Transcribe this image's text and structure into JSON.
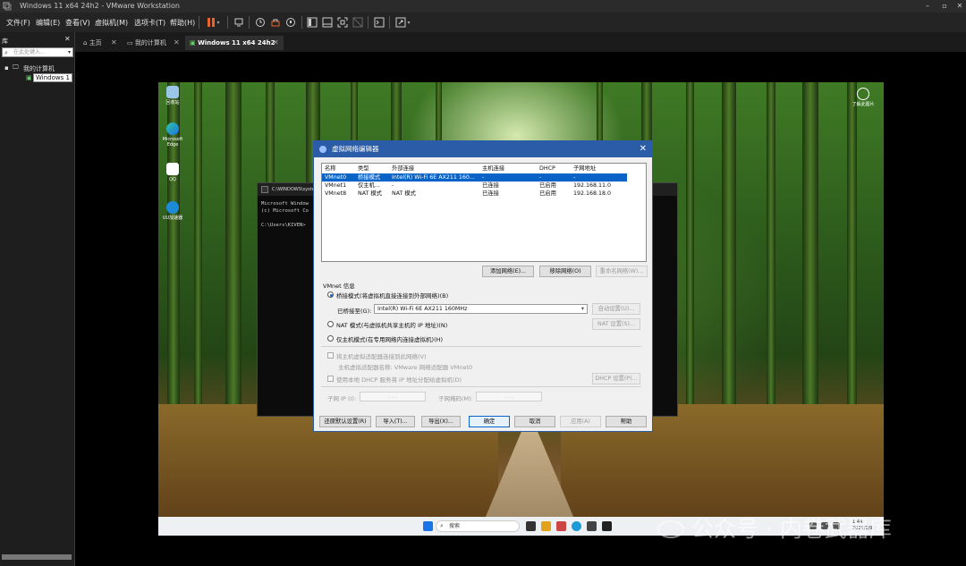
{
  "window": {
    "title": "Windows 11 x64 24h2 - VMware Workstation"
  },
  "menu": [
    "文件(F)",
    "编辑(E)",
    "查看(V)",
    "虚拟机(M)",
    "选项卡(T)",
    "帮助(H)"
  ],
  "library": {
    "title": "库",
    "search_placeholder": "在此处键入...",
    "tree_root": "我的计算机",
    "tree_vm": "Windows 1"
  },
  "tabs": [
    {
      "label": "主页"
    },
    {
      "label": "我的计算机"
    },
    {
      "label": "Windows 11 x64 24h2"
    }
  ],
  "desktop": {
    "icons": [
      {
        "label": "回收站"
      },
      {
        "label": "Microsoft Edge"
      },
      {
        "label": "QQ"
      },
      {
        "label": "UU加速器"
      }
    ],
    "top_right_label": "了解此图片",
    "taskbar_search": "搜索",
    "clock_time": "1:44",
    "clock_date": "2025/1/9"
  },
  "cmd": {
    "title": "C:\\WINDOWS\\syste",
    "lines": [
      "Microsoft Window",
      "(c) Microsoft Co",
      "",
      "C:\\Users\\KIVEN>"
    ]
  },
  "dialog": {
    "title": "虚拟网络编辑器",
    "columns": [
      "名称",
      "类型",
      "外部连接",
      "主机连接",
      "DHCP",
      "子网地址"
    ],
    "rows": [
      {
        "name": "VMnet0",
        "type": "桥接模式",
        "ext": "Intel(R) Wi-Fi 6E AX211 160...",
        "host": "-",
        "dhcp": "-",
        "subnet": "-"
      },
      {
        "name": "VMnet1",
        "type": "仅主机...",
        "ext": "-",
        "host": "已连接",
        "dhcp": "已启用",
        "subnet": "192.168.11.0"
      },
      {
        "name": "VMnet8",
        "type": "NAT 模式",
        "ext": "NAT 模式",
        "host": "已连接",
        "dhcp": "已启用",
        "subnet": "192.168.18.0"
      }
    ],
    "add_network": "添加网络(E)...",
    "remove_network": "移除网络(O)",
    "rename_network": "重命名网络(W)...",
    "vmnet_info": "VMnet 信息",
    "bridged_mode": "桥接模式(将虚拟机直接连接到外部网络)(B)",
    "bridged_to_label": "已桥接至(G):",
    "bridged_to_value": "Intel(R) Wi-Fi 6E AX211 160MHz",
    "auto_settings": "自动设置(U)...",
    "nat_mode": "NAT 模式(与虚拟机共享主机的 IP 地址)(N)",
    "nat_settings": "NAT 设置(S)...",
    "host_only": "仅主机模式(在专用网络内连接虚拟机)(H)",
    "connect_adapter": "将主机虚拟适配器连接到此网络(V)",
    "adapter_name": "主机虚拟适配器名称: VMware 网络适配器 VMnet0",
    "use_dhcp": "使用本地 DHCP 服务将 IP 地址分配给虚拟机(D)",
    "dhcp_settings": "DHCP 设置(P)...",
    "subnet_ip": "子网 IP (I):",
    "subnet_mask": "子网掩码(M):",
    "ip_placeholder": ".   .   .",
    "restore_defaults": "还原默认设置(R)",
    "import": "导入(T)...",
    "export": "导出(X)...",
    "ok": "确定",
    "cancel": "取消",
    "apply": "应用(A)",
    "help": "帮助"
  },
  "watermark": "公众号 · 内卷武器库",
  "colors": {
    "accent": "#2a5ca8",
    "selection": "#0a64c8"
  }
}
